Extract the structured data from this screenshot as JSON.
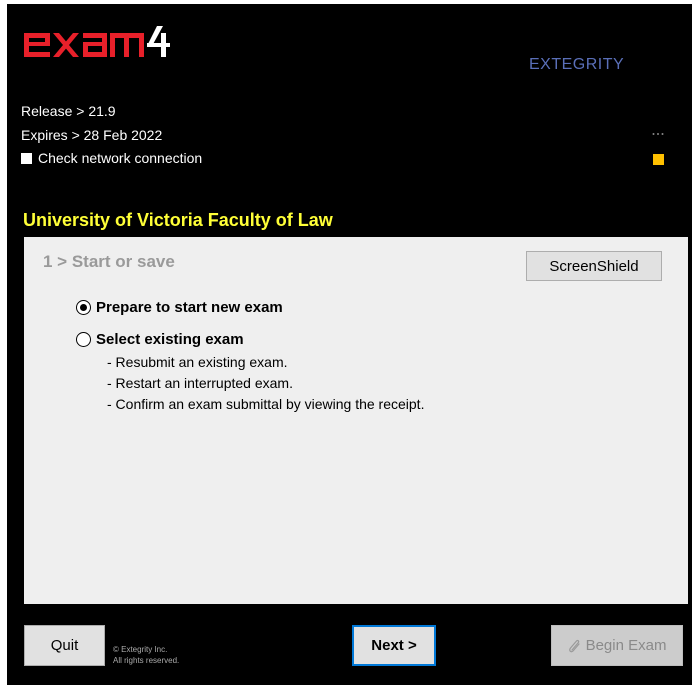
{
  "app": {
    "logo_text": "exam4",
    "vendor": "EXTEGRITY",
    "release": "Release > 21.9",
    "expires": "Expires > 28 Feb 2022",
    "network_check_label": "Check network connection",
    "status_color": "#ffc000",
    "institution": "University of Victoria Faculty of Law"
  },
  "panel": {
    "step_title": "1 > Start or save",
    "screenshield_label": "ScreenShield",
    "options": [
      {
        "label": "Prepare to start new exam",
        "selected": true
      },
      {
        "label": "Select existing exam",
        "selected": false
      }
    ],
    "existing_details": [
      "- Resubmit an existing exam.",
      "- Restart an interrupted exam.",
      "- Confirm an exam submittal by viewing the receipt."
    ]
  },
  "footer": {
    "quit_label": "Quit",
    "copyright_line1": "© Extegrity Inc.",
    "copyright_line2": "All rights reserved.",
    "next_label": "Next >",
    "begin_label": "Begin Exam",
    "begin_icon": "paperclip-icon"
  },
  "colors": {
    "background": "#000000",
    "logo_red": "#e8202a",
    "logo_white": "#ffffff",
    "institution_yellow": "#ffff37",
    "vendor_blue": "#5a6fb8",
    "focus_blue": "#0078d7"
  }
}
